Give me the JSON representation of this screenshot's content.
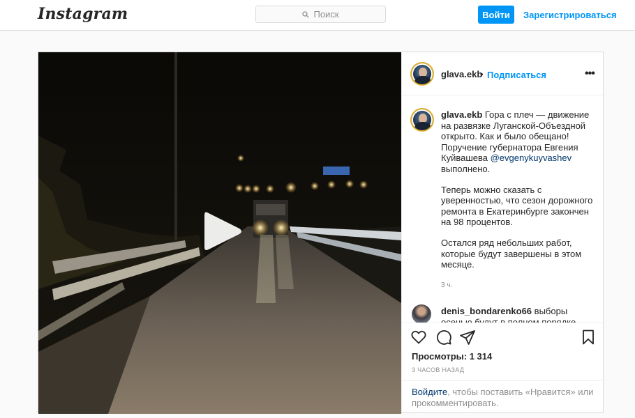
{
  "header": {
    "logo": "Instagram",
    "search_placeholder": "Поиск",
    "login_label": "Войти",
    "signup_label": "Зарегистрироваться"
  },
  "post": {
    "username": "glava.ekb",
    "separator": "•",
    "follow_label": "Подписаться",
    "more_label": "•••",
    "caption": {
      "username": "glava.ekb",
      "part1": "Гора с плеч — движение на развязке Луганской-Объездной открыто. Как и было обещано! Поручение губернатора Евгения Куйвашева",
      "mention": "@evgenykuyvashev",
      "part1_end": "выполнено.",
      "paragraph2": "Теперь можно сказать с уверенностью, что сезон дорожного ремонта в Екатеринбурге закончен на 98 процентов.",
      "paragraph3": "Остался ряд небольших работ, которые будут завершены в этом месяце.",
      "time": "3 ч."
    },
    "comment": {
      "username": "denis_bondarenko66",
      "text": "выборы",
      "text_cut": "осенью будут в полном порядке"
    },
    "icons": {
      "like": "heart-icon",
      "comment": "comment-icon",
      "share": "share-icon",
      "save": "bookmark-icon",
      "play": "play-icon"
    },
    "views_label": "Просмотры:",
    "views_count": "1 314",
    "time_ago": "3 часов назад",
    "login_prompt": {
      "link": "Войдите",
      "text": ", чтобы поставить «Нравится» или прокомментировать."
    }
  },
  "colors": {
    "accent": "#0095f6",
    "text": "#262626",
    "muted": "#8e8e8e",
    "border": "#dbdbdb"
  }
}
